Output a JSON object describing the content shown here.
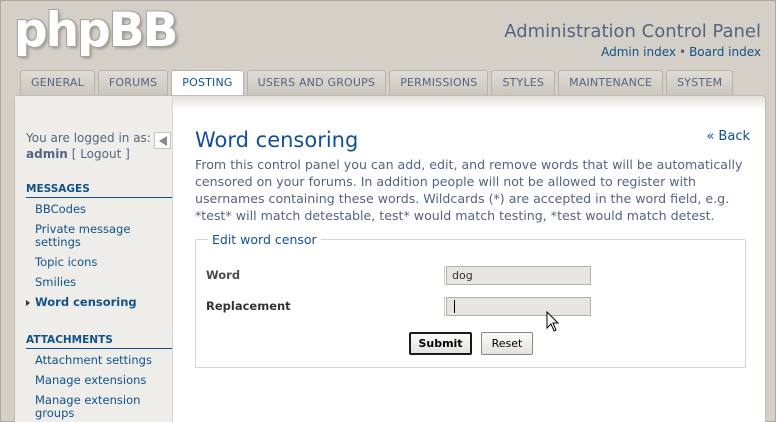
{
  "header": {
    "logo_text": "phpBB",
    "title": "Administration Control Panel",
    "link_admin_index": "Admin index",
    "link_sep": "•",
    "link_board_index": "Board index"
  },
  "tabs": [
    {
      "label": "GENERAL"
    },
    {
      "label": "FORUMS"
    },
    {
      "label": "POSTING",
      "active": true
    },
    {
      "label": "USERS AND GROUPS"
    },
    {
      "label": "PERMISSIONS"
    },
    {
      "label": "STYLES"
    },
    {
      "label": "MAINTENANCE"
    },
    {
      "label": "SYSTEM"
    }
  ],
  "sidebar": {
    "logged_in_text": "You are logged in as:",
    "username": "admin",
    "logout_open": "[",
    "logout_label": "Logout",
    "logout_close": "]",
    "sections": [
      {
        "heading": "MESSAGES",
        "items": [
          "BBCodes",
          "Private message settings",
          "Topic icons",
          "Smilies",
          "Word censoring"
        ],
        "active_index": 4
      },
      {
        "heading": "ATTACHMENTS",
        "items": [
          "Attachment settings",
          "Manage extensions",
          "Manage extension groups"
        ]
      }
    ]
  },
  "main": {
    "title": "Word censoring",
    "back_link": "« Back",
    "description": "From this control panel you can add, edit, and remove words that will be automatically censored on your forums. In addition people will not be allowed to register with usernames containing these words. Wildcards (*) are accepted in the word field, e.g. *test* will match detestable, test* would match testing, *test would match detest.",
    "form": {
      "legend": "Edit word censor",
      "word_label": "Word",
      "word_value": "dog",
      "replacement_label": "Replacement",
      "replacement_value": "",
      "submit_label": "Submit",
      "reset_label": "Reset"
    }
  },
  "colors": {
    "link": "#105289",
    "title": "#115098",
    "text": "#536482",
    "background": "#d4d0c8"
  }
}
